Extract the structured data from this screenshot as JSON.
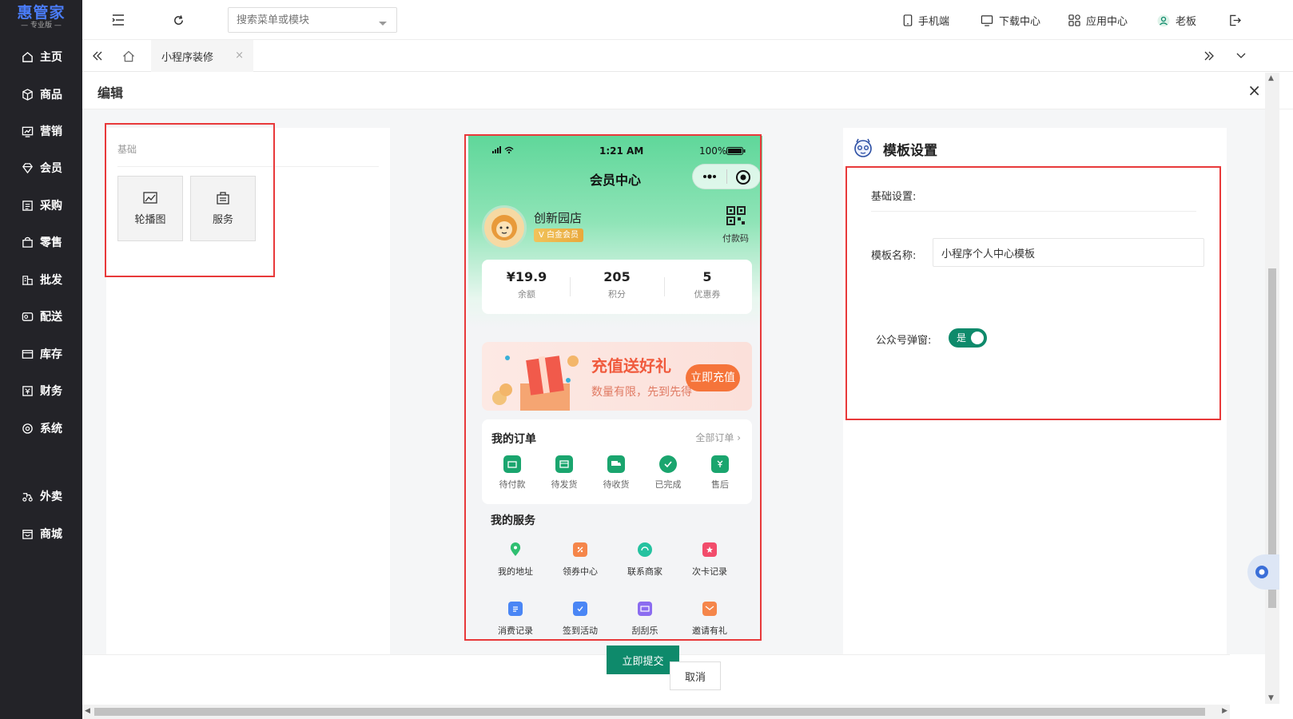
{
  "sidebar": {
    "logo_title": "惠管家",
    "logo_sub": "— 专业版 —",
    "items": [
      {
        "label": "主页",
        "icon": "home-icon"
      },
      {
        "label": "商品",
        "icon": "box-icon"
      },
      {
        "label": "营销",
        "icon": "chart-icon"
      },
      {
        "label": "会员",
        "icon": "diamond-icon"
      },
      {
        "label": "采购",
        "icon": "purchase-icon"
      },
      {
        "label": "零售",
        "icon": "bag-icon"
      },
      {
        "label": "批发",
        "icon": "building-icon"
      },
      {
        "label": "配送",
        "icon": "delivery-icon"
      },
      {
        "label": "库存",
        "icon": "inventory-icon"
      },
      {
        "label": "财务",
        "icon": "finance-icon"
      },
      {
        "label": "系统",
        "icon": "system-icon"
      },
      {
        "label": "外卖",
        "icon": "takeout-icon"
      },
      {
        "label": "商城",
        "icon": "mall-icon"
      }
    ]
  },
  "topbar": {
    "search_placeholder": "搜索菜单或模块",
    "mobile": "手机端",
    "download": "下载中心",
    "apps": "应用中心",
    "user": "老板"
  },
  "tabs": {
    "active": "小程序装修",
    "close": "×"
  },
  "edit": {
    "title": "编辑",
    "close": "×"
  },
  "components": {
    "category": "基础",
    "items": [
      {
        "label": "轮播图",
        "icon": "image-icon"
      },
      {
        "label": "服务",
        "icon": "service-icon"
      }
    ]
  },
  "phone": {
    "time": "1:21 AM",
    "battery": "100%",
    "title": "会员中心",
    "shop_name": "创新园店",
    "member_level": "V 白金会员",
    "pay_code": "付款码",
    "stats": [
      {
        "value": "¥19.9",
        "label": "余额"
      },
      {
        "value": "205",
        "label": "积分"
      },
      {
        "value": "5",
        "label": "优惠券"
      }
    ],
    "banner": {
      "title": "充值送好礼",
      "subtitle": "数量有限，先到先得",
      "button": "立即充值"
    },
    "orders": {
      "title": "我的订单",
      "all": "全部订单 ›",
      "items": [
        {
          "label": "待付款",
          "color": "#1aa56e"
        },
        {
          "label": "待发货",
          "color": "#1aa56e"
        },
        {
          "label": "待收货",
          "color": "#1aa56e"
        },
        {
          "label": "已完成",
          "color": "#1aa56e"
        },
        {
          "label": "售后",
          "color": "#1aa56e"
        }
      ]
    },
    "services": {
      "title": "我的服务",
      "items": [
        {
          "label": "我的地址",
          "color": "#2fbf71"
        },
        {
          "label": "领券中心",
          "color": "#f5864a"
        },
        {
          "label": "联系商家",
          "color": "#25c2a0"
        },
        {
          "label": "次卡记录",
          "color": "#f24c6b"
        },
        {
          "label": "消费记录",
          "color": "#4a86f5"
        },
        {
          "label": "签到活动",
          "color": "#4a86f5"
        },
        {
          "label": "刮刮乐",
          "color": "#8b6cf0"
        },
        {
          "label": "邀请有礼",
          "color": "#f5864a"
        }
      ]
    }
  },
  "settings": {
    "title": "模板设置",
    "basic": "基础设置:",
    "name_label": "模板名称:",
    "name_value": "小程序个人中心模板",
    "popup_label": "公众号弹窗:",
    "popup_value": "是"
  },
  "footer": {
    "submit": "立即提交",
    "cancel": "取消"
  },
  "colors": {
    "accent": "#0e8a6b",
    "sidebar": "#232328",
    "highlight": "#e8393a"
  }
}
